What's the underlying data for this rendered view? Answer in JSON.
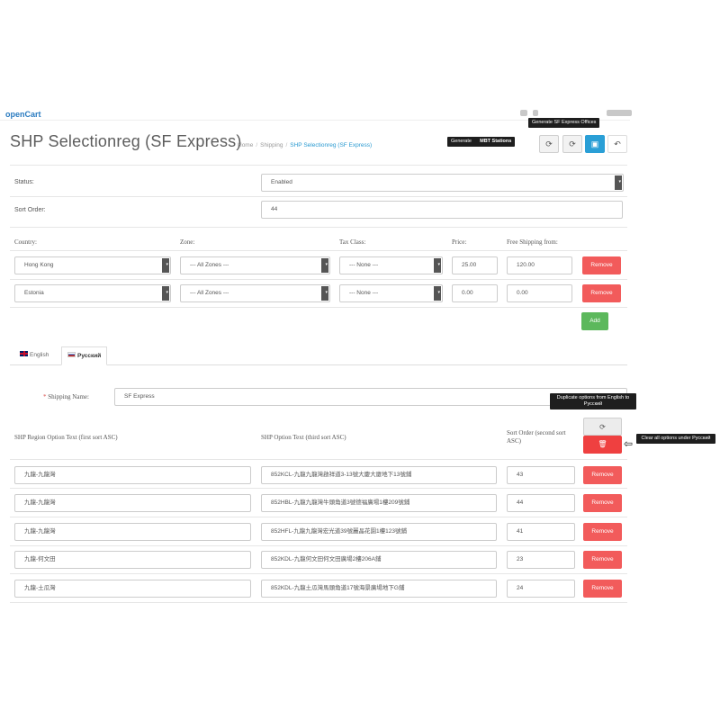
{
  "header": {
    "logo_fragment": "openCart",
    "title": "SHP Selectionreg (SF Express)",
    "breadcrumb": [
      "Home",
      "Shipping",
      "SHP Selectionreg (SF Express)"
    ]
  },
  "toolbar": {
    "tooltip_sf_offices": "Generate SF Express Offices",
    "tooltip_generate": "Generate",
    "tooltip_mbt": "MBT Stations",
    "refresh1_icon": "refresh-icon",
    "refresh2_icon": "refresh-icon",
    "save_icon": "save-icon",
    "back_icon": "reply-icon"
  },
  "form": {
    "status_label": "Status:",
    "status_value": "Enabled",
    "sort_order_label": "Sort Order:",
    "sort_order_value": "44"
  },
  "rates": {
    "headers": {
      "country": "Country:",
      "zone": "Zone:",
      "tax_class": "Tax Class:",
      "price": "Price:",
      "free_shipping": "Free Shipping from:"
    },
    "rows": [
      {
        "country": "Hong Kong",
        "zone": "--- All Zones ---",
        "tax_class": "--- None ---",
        "price": "25.00",
        "free": "120.00",
        "remove": "Remove"
      },
      {
        "country": "Estonia",
        "zone": "--- All Zones ---",
        "tax_class": "--- None ---",
        "price": "0.00",
        "free": "0.00",
        "remove": "Remove"
      }
    ],
    "add_label": "Add"
  },
  "tabs": [
    {
      "label": "English",
      "flag": "uk-flag-icon"
    },
    {
      "label": "Русский",
      "flag": "ru-flag-icon"
    }
  ],
  "russian": {
    "shipping_name_label": "Shipping Name:",
    "shipping_name_value": "SF Express",
    "tooltip_duplicate": "Duplicate options from English to Русский",
    "tooltip_clear": "Clear all options under Русский",
    "headers": {
      "region": "SHP Region Option Text (first sort ASC)",
      "option": "SHP Option Text (third sort ASC)",
      "sort": "Sort Order (second sort ASC)"
    },
    "rows": [
      {
        "region": "九龍-九龍灣",
        "option": "852KCL-九龍九龍灣啟祥道3-13號大慶大廈地下13號鋪",
        "sort": "43",
        "remove": "Remove"
      },
      {
        "region": "九龍-九龍灣",
        "option": "852HBL-九龍九龍灣牛頭角道3號德福廣場1樓209號鋪",
        "sort": "44",
        "remove": "Remove"
      },
      {
        "region": "九龍-九龍灣",
        "option": "852HFL-九龍九龍灣宏光道39號麗晶花園1樓123號鋪",
        "sort": "41",
        "remove": "Remove"
      },
      {
        "region": "九龍-何文田",
        "option": "852KDL-九龍何文田何文田廣場2樓206A鋪",
        "sort": "23",
        "remove": "Remove"
      },
      {
        "region": "九龍-土瓜灣",
        "option": "852KDL-九龍土瓜灣馬頭角道17號海景廣場地下G鋪",
        "sort": "24",
        "remove": "Remove"
      }
    ]
  },
  "colors": {
    "remove": "#f25b5b",
    "add": "#5cb85c",
    "primary": "#2a9fd6",
    "clear": "#ef4040"
  }
}
